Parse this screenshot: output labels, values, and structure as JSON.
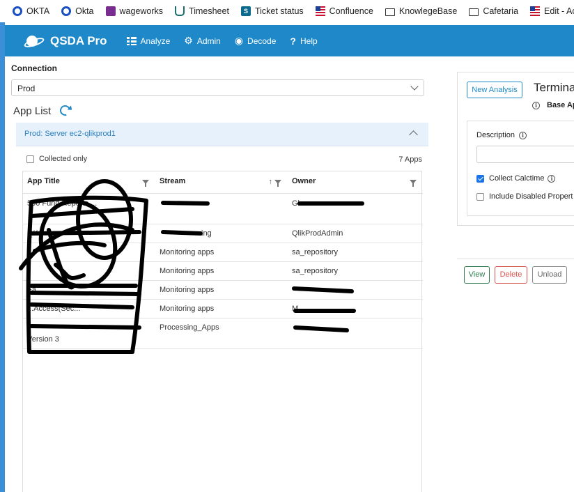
{
  "bookmarks": [
    {
      "label": "OKTA",
      "icon": "okta-icon"
    },
    {
      "label": "Okta",
      "icon": "okta-icon"
    },
    {
      "label": "wageworks",
      "icon": "wageworks-icon"
    },
    {
      "label": "Timesheet",
      "icon": "timesheet-icon"
    },
    {
      "label": "Ticket status",
      "icon": "sharepoint-icon"
    },
    {
      "label": "Confluence",
      "icon": "confluence-icon"
    },
    {
      "label": "KnowlegeBase",
      "icon": "folder-icon"
    },
    {
      "label": "Cafetaria",
      "icon": "folder-icon"
    },
    {
      "label": "Edit - Act",
      "icon": "confluence-icon"
    }
  ],
  "header": {
    "brand": "QSDA Pro",
    "color": "#1e88c8",
    "nav": [
      {
        "label": "Analyze",
        "icon": "analyze-icon"
      },
      {
        "label": "Admin",
        "icon": "gear-icon"
      },
      {
        "label": "Decode",
        "icon": "eye-icon"
      },
      {
        "label": "Help",
        "icon": "help-icon"
      }
    ]
  },
  "connection": {
    "label": "Connection",
    "selected": "Prod"
  },
  "app_list": {
    "title": "App List",
    "server": "Prod: Server ec2-qlikprod1",
    "collected_only_label": "Collected only",
    "collected_only_checked": false,
    "count": "7 Apps",
    "columns": [
      "App Title",
      "Stream",
      "Owner"
    ],
    "rows": [
      {
        "title": "500 Fund Reports ... ",
        "stream": "",
        "owner": "Gla"
      },
      {
        "title": "QK",
        "stream": "ing",
        "owner": "QlikProdAdmin"
      },
      {
        "title": "",
        "stream": "Monitoring apps",
        "owner": "sa_repository"
      },
      {
        "title": "",
        "stream": "Monitoring apps",
        "owner": "sa_repository"
      },
      {
        "title": "Fa",
        "stream": "Monitoring apps",
        "owner": ""
      },
      {
        "title": "...Access(Sec...",
        "stream": "Monitoring apps",
        "owner": "M"
      },
      {
        "title": "Version 3",
        "stream": "Processing_Apps",
        "owner": ""
      }
    ]
  },
  "analysis": {
    "new_button": "New Analysis",
    "title": "Termina",
    "base_app": "Base Ap",
    "description_label": "Description",
    "description_value": "",
    "collect_calctime_label": "Collect Calctime",
    "collect_calctime_checked": true,
    "include_disabled_label": "Include Disabled Propert",
    "include_disabled_checked": false
  },
  "actions": {
    "view": "View",
    "delete": "Delete",
    "unload": "Unload"
  }
}
